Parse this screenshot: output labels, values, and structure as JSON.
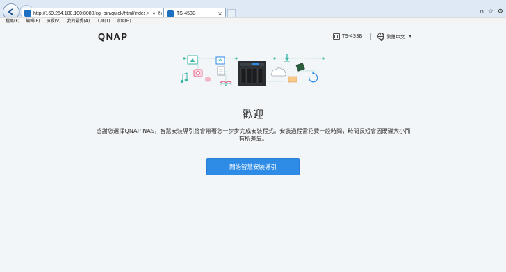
{
  "browser": {
    "url": "http://169.254.100.100:8080/cgi-bin/quick/html/index.html#ind",
    "url_search_icon": "search-icon",
    "url_refresh_icon": "refresh-icon",
    "tab_title": "TS-453B",
    "tab_close": "×",
    "right_icons": [
      "⌂",
      "☆",
      "⚙"
    ]
  },
  "menu": {
    "items": [
      "檔案(F)",
      "編輯(E)",
      "檢視(V)",
      "我的最愛(A)",
      "工具(T)",
      "說明(H)"
    ]
  },
  "header": {
    "logo": "QNAP",
    "model": "TS-453B",
    "language": "繁體中文",
    "caret": "▾"
  },
  "main": {
    "title": "歡迎",
    "description": "感謝您選擇QNAP NAS，智慧安裝導引將會帶著您一步步完成安裝程式。安裝過程需花費一段時間，時間長短會因硬碟大小而有所差異。",
    "start_button": "開始智慧安裝導引"
  },
  "colors": {
    "accent": "#2e8be6",
    "background": "#f3f6f8",
    "illustration_teal": "#3fb7a8",
    "illustration_pink": "#e36a8d",
    "illustration_blue": "#2e8be6"
  }
}
